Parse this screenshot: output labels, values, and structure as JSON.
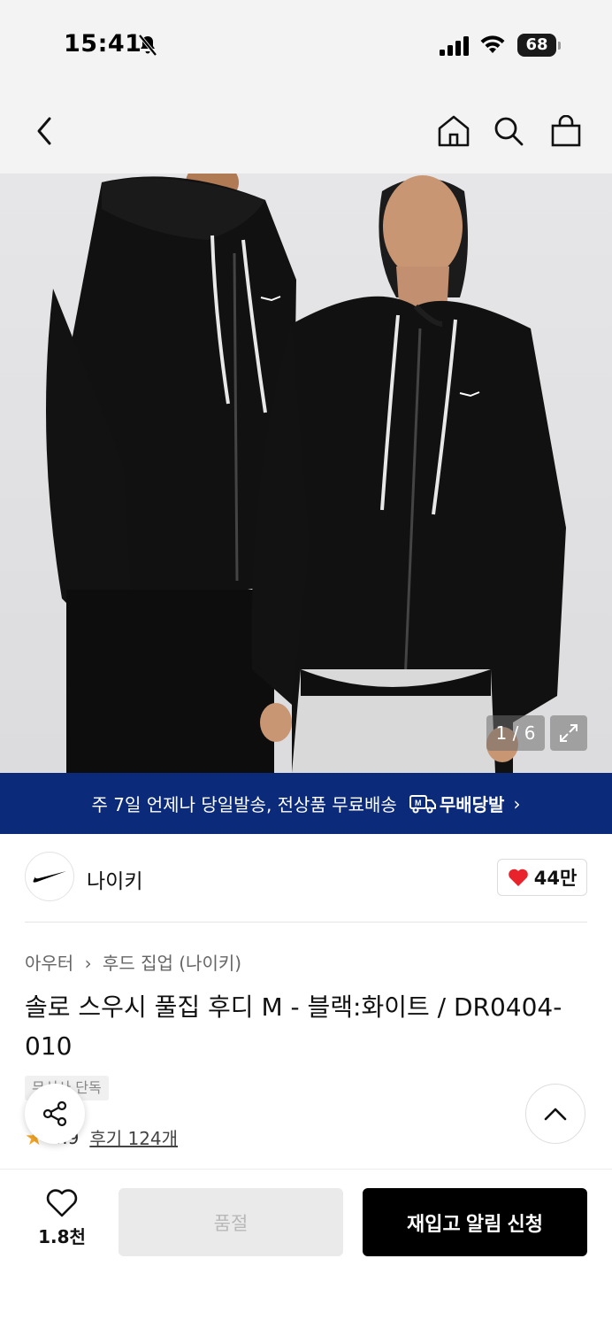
{
  "status_bar": {
    "time": "15:41",
    "battery": "68",
    "icons": [
      "bell-off-icon",
      "cellular-signal-icon",
      "wifi-icon",
      "battery-icon"
    ]
  },
  "nav": {
    "icons": [
      "back-chevron-icon",
      "home-icon",
      "search-icon",
      "shopping-bag-icon"
    ]
  },
  "gallery": {
    "counter": "1 / 6",
    "current": 1,
    "total": 6
  },
  "promo": {
    "text": "주 7일 언제나 당일발송, 전상품 무료배송",
    "badge": "무배당발",
    "chevron": "›"
  },
  "brand": {
    "name": "나이키",
    "likes": "44만"
  },
  "product": {
    "breadcrumb": [
      "아우터",
      "후드 집업 (나이키)"
    ],
    "breadcrumb_sep": "›",
    "title": "솔로 스우시 풀집 후디 M - 블랙:화이트 / DR0404-010",
    "tag": "무신사 단독",
    "rating": "4.9",
    "reviews": "후기 124개"
  },
  "bottom_bar": {
    "wish_count": "1.8천",
    "soldout_label": "품절",
    "restock_label": "재입고 알림 신청"
  },
  "colors": {
    "promo_bg": "#0b2a7a",
    "heart": "#e8232b",
    "star": "#f5a623"
  }
}
